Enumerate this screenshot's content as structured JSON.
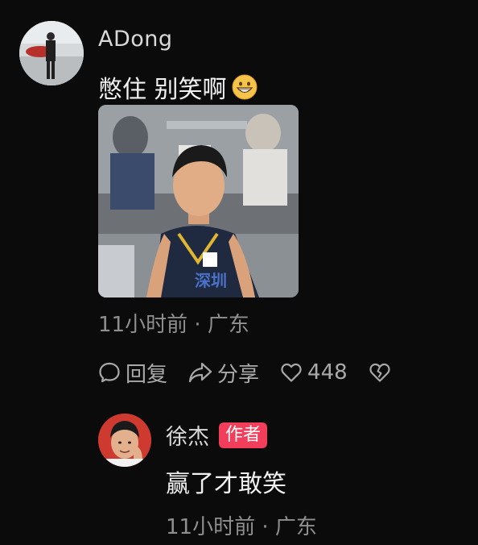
{
  "comment": {
    "username": "ADong",
    "text": "憋住 别笑啊",
    "emoji_icon": "grinning-face-icon",
    "meta": "11小时前 · 广东"
  },
  "actions": {
    "reply_label": "回复",
    "share_label": "分享",
    "like_count": "448"
  },
  "reply": {
    "username": "徐杰",
    "badge": "作者",
    "text": "赢了才敢笑",
    "meta": "11小时前 · 广东"
  },
  "colors": {
    "background": "#0b0b0b",
    "badge": "#f23e5b"
  }
}
